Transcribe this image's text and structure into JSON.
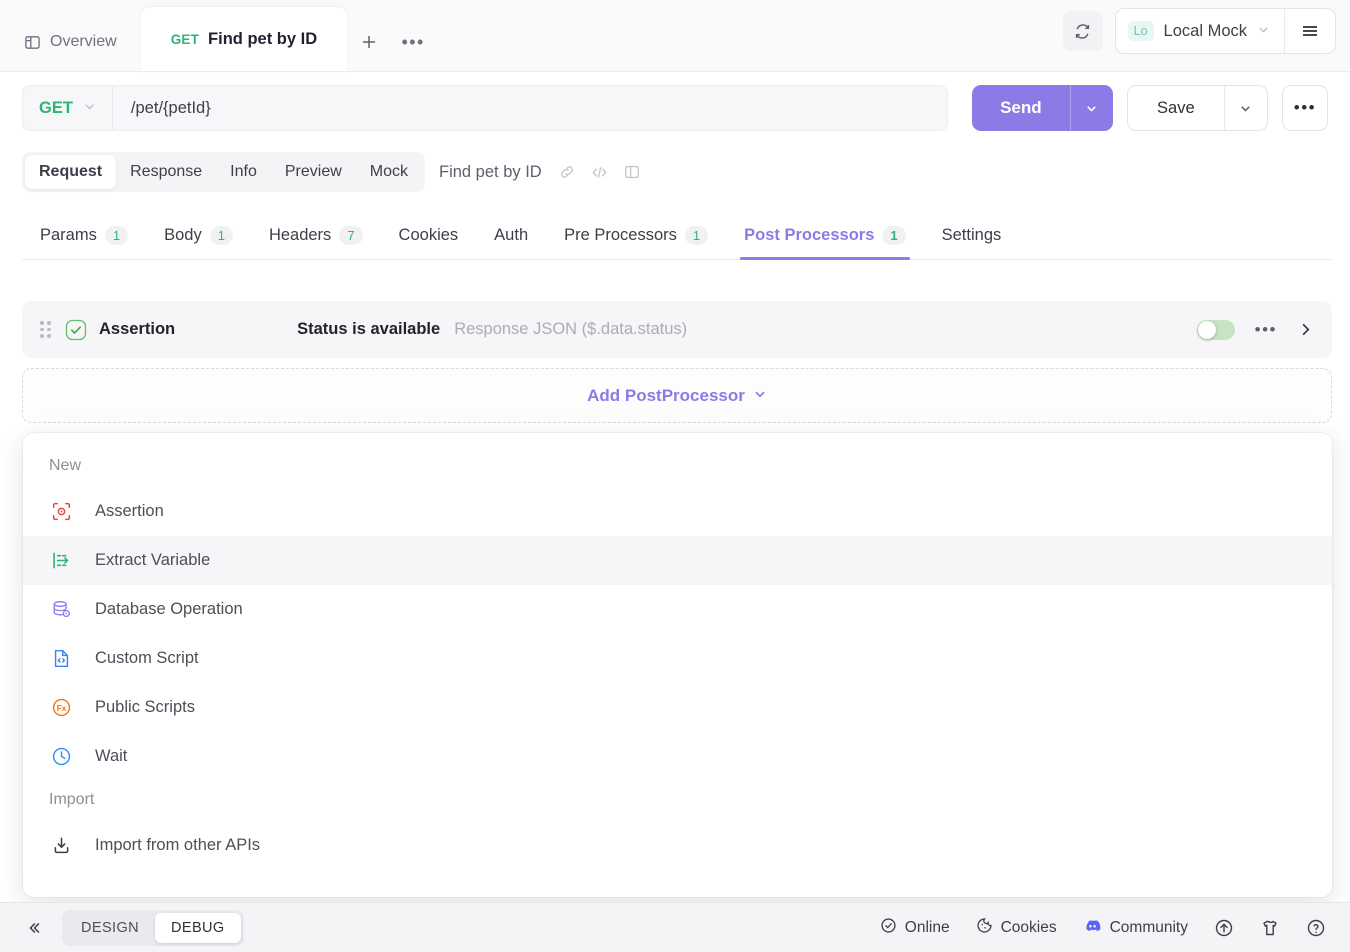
{
  "tabbar": {
    "overview_label": "Overview",
    "overview_icon": "layout-panel-icon",
    "request_tab": {
      "method": "GET",
      "title": "Find pet by ID"
    },
    "add_tab_label": "+",
    "more_tabs_label": "•••",
    "refresh_icon": "refresh-icon",
    "environment": {
      "chip": "Lo",
      "name": "Local Mock"
    },
    "hamburger_icon": "hamburger-menu-icon"
  },
  "urlbar": {
    "method": "GET",
    "url": "/pet/{petId}",
    "send_label": "Send",
    "save_label": "Save",
    "more_label": "•••"
  },
  "subtabs": {
    "pills": [
      {
        "label": "Request",
        "active": true
      },
      {
        "label": "Response",
        "active": false
      },
      {
        "label": "Info",
        "active": false
      },
      {
        "label": "Preview",
        "active": false
      },
      {
        "label": "Mock",
        "active": false
      }
    ],
    "title": "Find pet by ID",
    "icons": [
      "link-icon",
      "code-icon",
      "panel-toggle-icon"
    ]
  },
  "section_tabs": [
    {
      "label": "Params",
      "count": "1",
      "active": false
    },
    {
      "label": "Body",
      "count": "1",
      "active": false
    },
    {
      "label": "Headers",
      "count": "7",
      "active": false
    },
    {
      "label": "Cookies",
      "count": "",
      "active": false
    },
    {
      "label": "Auth",
      "count": "",
      "active": false
    },
    {
      "label": "Pre Processors",
      "count": "1",
      "active": false
    },
    {
      "label": "Post Processors",
      "count": "1",
      "active": true
    },
    {
      "label": "Settings",
      "count": "",
      "active": false
    }
  ],
  "processor": {
    "name": "Assertion",
    "detail": "Status is available",
    "source": "Response JSON ($.data.status)",
    "status_icon": "check-circle-icon",
    "drag_icon": "drag-handle-icon",
    "toggle_state": "off",
    "menu_label": "•••",
    "expand_icon": "chevron-right-icon"
  },
  "add_processor": {
    "label": "Add PostProcessor",
    "caret": "chevron-down-icon"
  },
  "dropdown": {
    "groups": [
      {
        "label": "New",
        "items": [
          {
            "label": "Assertion",
            "icon": "assertion-target-icon",
            "color": "#e8453c",
            "hover": false
          },
          {
            "label": "Extract Variable",
            "icon": "extract-variable-icon",
            "color": "#2bb673",
            "hover": true
          },
          {
            "label": "Database Operation",
            "icon": "database-icon",
            "color": "#9b7ef0",
            "hover": false
          },
          {
            "label": "Custom Script",
            "icon": "custom-script-icon",
            "color": "#3b82f6",
            "hover": false
          },
          {
            "label": "Public Scripts",
            "icon": "public-scripts-fx-icon",
            "color": "#f0761a",
            "hover": false
          },
          {
            "label": "Wait",
            "icon": "wait-clock-icon",
            "color": "#2f8ef4",
            "hover": false
          }
        ]
      },
      {
        "label": "Import",
        "items": [
          {
            "label": "Import from other APIs",
            "icon": "import-icon",
            "color": "#3b4049",
            "hover": false
          }
        ]
      }
    ]
  },
  "statusbar": {
    "collapse_icon": "collapse-left-icon",
    "modes": [
      {
        "label": "DESIGN",
        "active": false
      },
      {
        "label": "DEBUG",
        "active": true
      }
    ],
    "items": [
      {
        "label": "Online",
        "icon": "check-circle-icon"
      },
      {
        "label": "Cookies",
        "icon": "cookie-icon"
      },
      {
        "label": "Community",
        "icon": "discord-icon"
      }
    ],
    "icon_buttons": [
      "upload-icon",
      "shirt-icon",
      "help-circle-icon"
    ]
  },
  "colors": {
    "accent_purple": "#8c7ae6",
    "method_green": "#2bb673",
    "panel_gray": "#f6f6f8"
  }
}
